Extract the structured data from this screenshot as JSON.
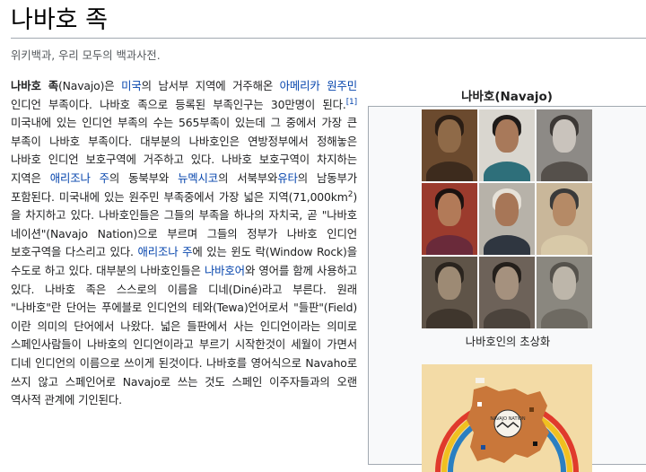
{
  "page": {
    "title": "나바호 족",
    "tagline": "위키백과, 우리 모두의 백과사전."
  },
  "article": {
    "bold_name": "나바호 족",
    "t1": "(Navajo)은 ",
    "link_usa": "미국",
    "t2": "의 남서부 지역에 거주해온 ",
    "link_native": "아메리카 원주민",
    "t3": " 인디언 부족이다. 나바호 족으로 등록된 부족인구는 30만명이 된다.",
    "ref1": "[1]",
    "t4": " 미국내에 있는 인디언 부족의 수는 565부족이 있는데 그 중에서 가장 큰 부족이 나바호 부족이다. 대부분의 나바호인은 연방정부에서 정해놓은 나바호 인디언 보호구역에 거주하고 있다. 나바호 보호구역이 차지하는 지역은 ",
    "link_az1": "애리조나 주",
    "t5": "의 동북부와 ",
    "link_nm": "뉴멕시코",
    "t6": "의 서북부와",
    "link_ut": "유타",
    "t7": "의 남동부가 포함된다. 미국내에 있는 원주민 부족중에서 가장 넓은 지역(71,000km",
    "sup2": "2",
    "t8": ")을 차지하고 있다. 나바호인들은 그들의 부족을 하나의 자치국, 곧 \"나바호 네이션\"(Navajo Nation)으로 부르며 그들의 정부가 나바호 인디언 보호구역을 다스리고 있다. ",
    "link_az2": "애리조나 주",
    "t9": "에 있는 윈도 락(Window Rock)을 수도로 하고 있다. 대부분의 나바호인들은 ",
    "link_navlang": "나바호어",
    "t10": "와 영어를 함께 사용하고 있다. 나바호 족은 스스로의 이름을 디네(Diné)라고 부른다. 원래 \"나바호\"란 단어는 푸에블로 인디언의 테와(Tewa)언어로서 \"들판\"(Field)이란 의미의 단어에서 나왔다. 넓은 들판에서 사는 인디언이라는 의미로 스페인사람들이 나바호의 인디언이라고 부르기 시작한것이 세월이 가면서 디네 인디언의 이름으로 쓰이게 된것이다. 나바호를 영어식으로 Navaho로 쓰지 않고 스페인어로 Navajo로 쓰는 것도 스페인 이주자들과의 오랜 역사적 관계에 기인된다."
  },
  "infobox": {
    "title": "나바호(Navajo)",
    "caption": "나바호인의 초상화",
    "flag_seal_text": "NAVAJO NATION"
  },
  "colors": {
    "link": "#0645ad",
    "rule": "#a2a9b1",
    "infobox_bg": "#f8f9fa",
    "flag_bg": "#f3dba6",
    "flag_land": "#c9773a",
    "rainbow": [
      "#e03a2c",
      "#f0c020",
      "#2a7fc1"
    ]
  }
}
